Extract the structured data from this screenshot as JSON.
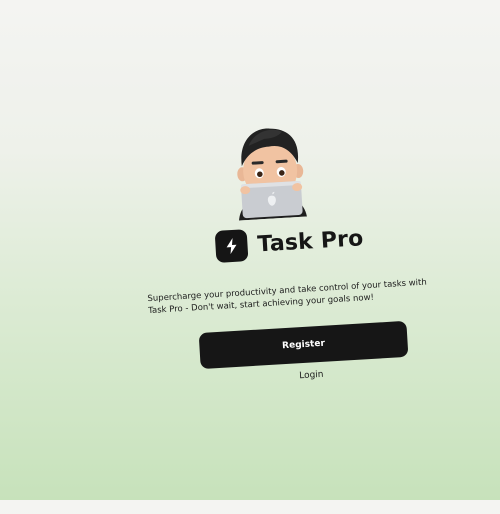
{
  "app": {
    "name": "Task Pro",
    "logo_icon": "lightning-icon",
    "avatar": "memoji-with-laptop"
  },
  "welcome": {
    "tagline": "Supercharge your productivity and take control of your tasks with Task Pro - Don't wait, start achieving your goals now!",
    "register_label": "Register",
    "login_label": "Login"
  },
  "colors": {
    "accent": "#161616",
    "background_top": "#f4f4f2",
    "background_bottom": "#c7e2bb"
  }
}
